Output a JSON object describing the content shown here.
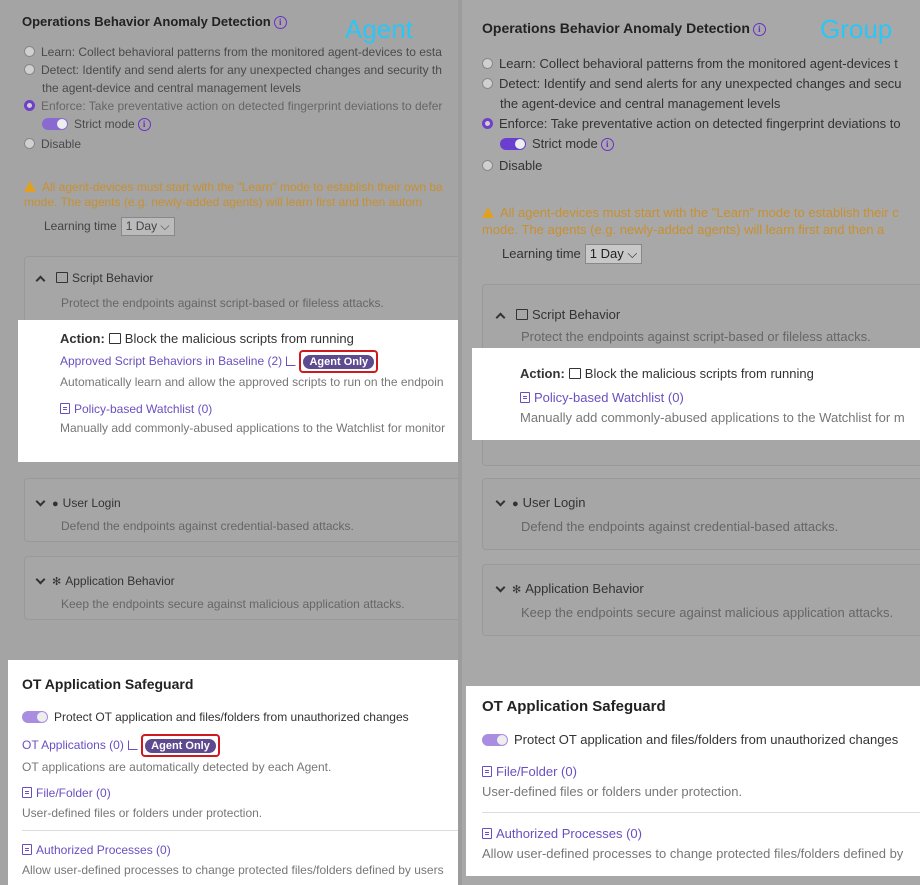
{
  "agent": {
    "panel_title": "Operations Behavior Anomaly Detection",
    "label": "Agent",
    "modes": [
      "Learn: Collect behavioral patterns from the monitored agent-devices to esta",
      "Detect: Identify and send alerts for any unexpected changes and security th",
      "the agent-device and central management levels",
      "Enforce: Take preventative action on detected fingerprint deviations to defer",
      "Disable"
    ],
    "strict_mode": "Strict mode",
    "warning_l1": "All agent-devices must start with the \"Learn\" mode to establish their own ba",
    "warning_l2": "mode. The agents (e.g. newly-added agents) will learn first and then autom",
    "learning_label": "Learning time",
    "learning_value": "1 Day",
    "script": {
      "title": "Script Behavior",
      "desc": "Protect the endpoints against script-based or fileless attacks.",
      "action_label": "Action:",
      "action_text": "Block the malicious scripts from running",
      "approved_link": "Approved Script Behaviors in Baseline (2)",
      "approved_desc": "Automatically learn and allow the approved scripts to run on the endpoin",
      "badge": "Agent Only",
      "watchlist_link": "Policy-based Watchlist (0)",
      "watchlist_desc": "Manually add commonly-abused applications to the Watchlist for monitor"
    },
    "user_login": {
      "title": "User Login",
      "desc": "Defend the endpoints against credential-based attacks."
    },
    "app_behavior": {
      "title": "Application Behavior",
      "desc": "Keep the endpoints secure against malicious application attacks."
    },
    "ot": {
      "title": "OT Application Safeguard",
      "toggle_text": "Protect OT application and files/folders from unauthorized changes",
      "apps_link": "OT Applications (0)",
      "badge": "Agent Only",
      "apps_desc": "OT applications are automatically detected by each Agent.",
      "file_link": "File/Folder (0)",
      "file_desc": "User-defined files or folders under protection.",
      "proc_link": "Authorized Processes (0)",
      "proc_desc": "Allow user-defined processes to change protected files/folders defined by users"
    }
  },
  "group": {
    "panel_title": "Operations Behavior Anomaly Detection",
    "label": "Group",
    "modes": [
      "Learn: Collect behavioral patterns from the monitored agent-devices t",
      "Detect: Identify and send alerts for any unexpected changes and secu",
      "the agent-device and central management levels",
      "Enforce: Take preventative action on detected fingerprint deviations to",
      "Disable"
    ],
    "strict_mode": "Strict mode",
    "warning_l1": "All agent-devices must start with the \"Learn\" mode to establish their c",
    "warning_l2": "mode. The agents (e.g. newly-added agents) will learn first and then a",
    "learning_label": "Learning time",
    "learning_value": "1 Day",
    "script": {
      "title": "Script Behavior",
      "desc": "Protect the endpoints against script-based or fileless attacks.",
      "action_label": "Action:",
      "action_text": "Block the malicious scripts from running",
      "watchlist_link": "Policy-based Watchlist (0)",
      "watchlist_desc": "Manually add commonly-abused applications to the Watchlist for m"
    },
    "user_login": {
      "title": "User Login",
      "desc": "Defend the endpoints against credential-based attacks."
    },
    "app_behavior": {
      "title": "Application Behavior",
      "desc": "Keep the endpoints secure against malicious application attacks."
    },
    "ot": {
      "title": "OT Application Safeguard",
      "toggle_text": "Protect OT application and files/folders from unauthorized changes",
      "file_link": "File/Folder (0)",
      "file_desc": "User-defined files or folders under protection.",
      "proc_link": "Authorized Processes (0)",
      "proc_desc": "Allow user-defined processes to change protected files/folders defined by"
    }
  }
}
